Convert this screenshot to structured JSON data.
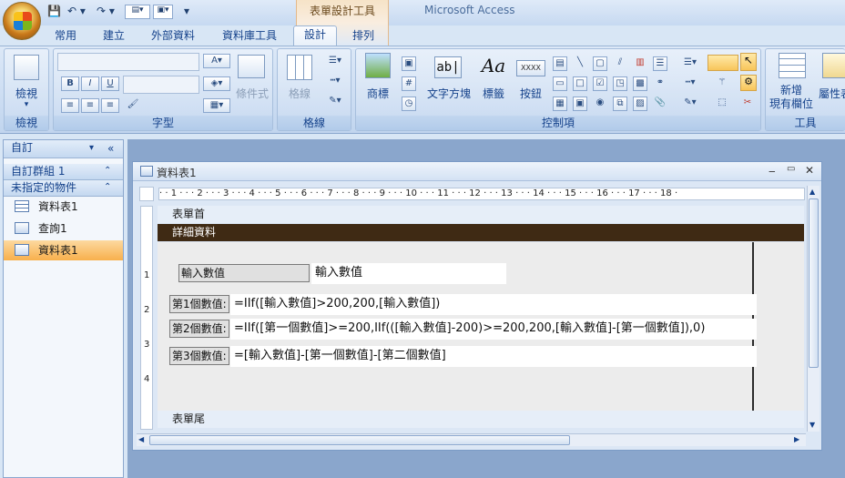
{
  "window": {
    "app_title": "Microsoft Access",
    "context_tab_title": "表單設計工具"
  },
  "tabs": [
    "常用",
    "建立",
    "外部資料",
    "資料庫工具",
    "設計",
    "排列"
  ],
  "ribbon": {
    "groups": {
      "views": "檢視",
      "font": "字型",
      "gridlines": "格線",
      "controls": "控制項",
      "tools": "工具"
    },
    "buttons": {
      "view": "檢視",
      "conditional_format": "條件式",
      "gridlines": "格線",
      "logo": "商標",
      "textbox": "文字方塊",
      "label": "標籤",
      "button": "按鈕",
      "add_existing_fields": "新增\n現有欄位",
      "property_sheet": "屬性表"
    },
    "textbox_icon_text": "ab|",
    "label_icon_text": "Aa",
    "button_icon_text": "XXXX"
  },
  "nav": {
    "header": "自訂",
    "groups": [
      {
        "label": "自訂群組 1"
      },
      {
        "label": "未指定的物件"
      }
    ],
    "items": [
      {
        "label": "資料表1",
        "icon": "table-icon"
      },
      {
        "label": "查詢1",
        "icon": "query-icon"
      },
      {
        "label": "資料表1",
        "icon": "form-icon",
        "selected": true
      }
    ]
  },
  "document": {
    "title": "資料表1",
    "sections": {
      "header": "表單首",
      "detail": "詳細資料",
      "footer": "表單尾"
    },
    "ruler_h": "· · 1 · · · 2 · · · 3 · · · 4 · · · 5 · · · 6 · · · 7 · · · 8 · · · 9 · · · 10 · · · 11 · · · 12 · · · 13 · · · 14 · · · 15 · · · 16 · · · 17 · · · 18 ·",
    "ruler_v": [
      "1",
      "2",
      "3",
      "4"
    ],
    "controls": [
      {
        "label": "輸入數值",
        "value": "輸入數值"
      },
      {
        "label": "第1個數值:",
        "value": "=IIf([輸入數值]>200,200,[輸入數值])"
      },
      {
        "label": "第2個數值:",
        "value": "=IIf([第一個數值]>=200,IIf(([輸入數值]-200)>=200,200,[輸入數值]-[第一個數值]),0)"
      },
      {
        "label": "第3個數值:",
        "value": "=[輸入數值]-[第一個數值]-[第二個數值]"
      }
    ]
  }
}
